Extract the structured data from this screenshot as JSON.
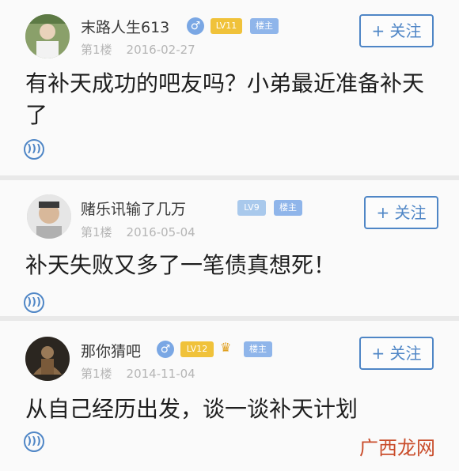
{
  "posts": [
    {
      "username": "末路人生613",
      "floor": "第1楼",
      "date": "2016-02-27",
      "gender": "♂",
      "level": "LV11",
      "owner_badge": "楼主",
      "follow_label": "+ 关注",
      "content": "有补天成功的吧友吗？小弟最近准备补天了"
    },
    {
      "username": "赌乐讯输了几万",
      "floor": "第1楼",
      "date": "2016-05-04",
      "level": "LV9",
      "owner_badge": "楼主",
      "follow_label": "+ 关注",
      "content": "补天失败又多了一笔债真想死！"
    },
    {
      "username": "那你猜吧",
      "floor": "第1楼",
      "date": "2014-11-04",
      "gender": "♂",
      "level": "LV12",
      "owner_badge": "楼主",
      "follow_label": "+ 关注",
      "content": "从自己经历出发，谈一谈补天计划"
    }
  ],
  "watermark": "广西龙网",
  "colors": {
    "accent": "#4f86c6",
    "level_gold": "#f0c23a",
    "meta_gray": "#b5b5b5"
  },
  "icons": {
    "voice": "speaker-icon",
    "gender": "male-icon",
    "crown": "crown-icon"
  }
}
